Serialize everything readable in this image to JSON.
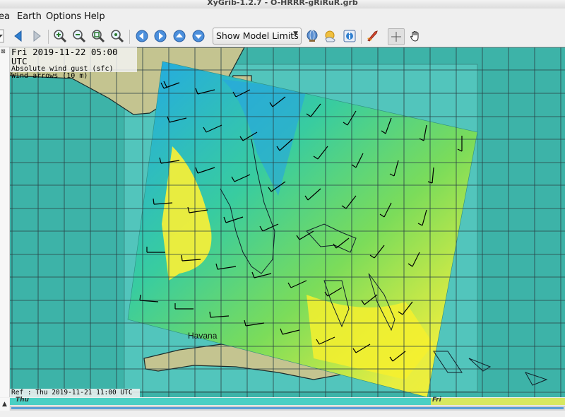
{
  "window": {
    "title": "XyGrib-1.2.7 - O-HRRR-gRiRuR.grb"
  },
  "menu": {
    "items": [
      "ea",
      "Earth",
      "Options",
      "Help"
    ]
  },
  "toolbar": {
    "combo_value": "Show Model Limits"
  },
  "map": {
    "info_lines": [
      "Fri 2019-11-22 05:00 UTC",
      "Absolute wind gust (sfc)",
      "Wind arrows (10 m)"
    ],
    "ref_text": "Ref : Thu 2019-11-21 11:00 UTC",
    "city_label": "Havana"
  },
  "timeline": {
    "labels": [
      "Thu",
      "Fri"
    ]
  },
  "colors": {
    "sea": "#3db3a8",
    "land": "#c4c490",
    "wind_low": "#2ab0e6",
    "wind_mid": "#3fd490",
    "wind_high": "#fff03c"
  }
}
